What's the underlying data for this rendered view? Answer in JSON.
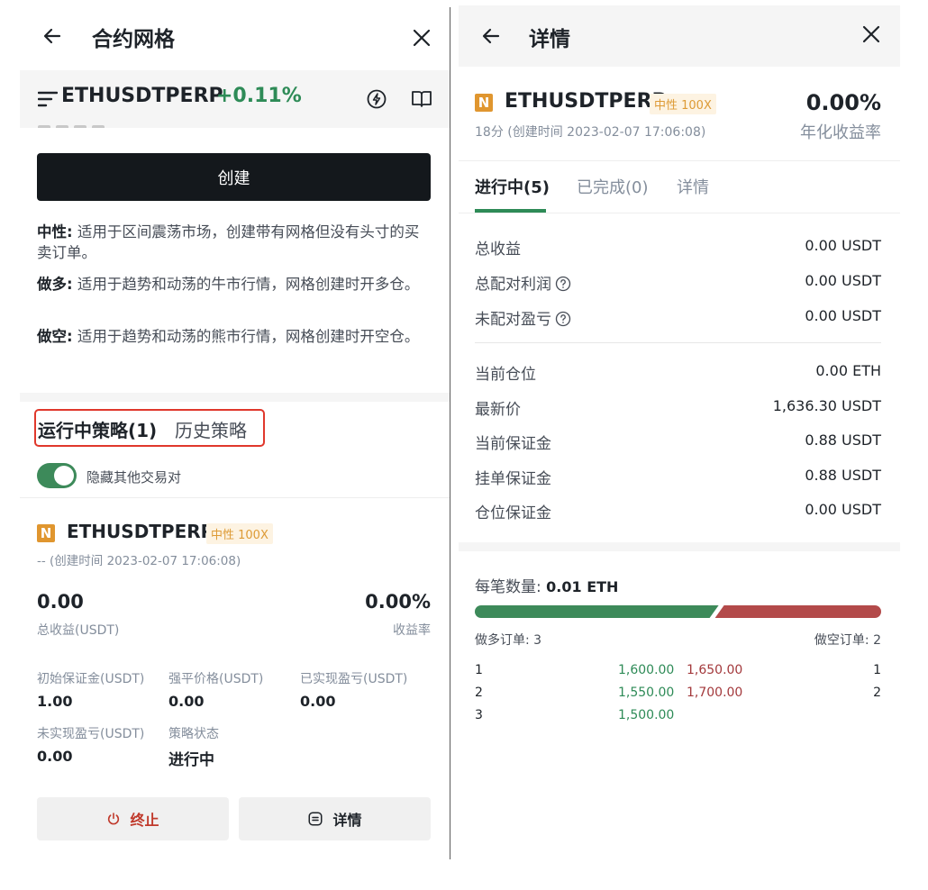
{
  "left": {
    "nav_title": "合约网格",
    "pair": {
      "symbol": "ETHUSDTPERP",
      "change": "+0.11%"
    },
    "create_label": "创建",
    "descriptions": [
      {
        "term": "中性:",
        "text": "适用于区间震荡市场，创建带有网格但没有头寸的买卖订单。"
      },
      {
        "term": "做多:",
        "text": "适用于趋势和动荡的牛市行情，网格创建时开多仓。"
      },
      {
        "term": "做空:",
        "text": "适用于趋势和动荡的熊市行情，网格创建时开空仓。"
      }
    ],
    "tabs": {
      "running": "运行中策略(1)",
      "history": "历史策略"
    },
    "toggle_label": "隐藏其他交易对",
    "card": {
      "badge": "N",
      "symbol": "ETHUSDTPERP",
      "tag": "中性 100X",
      "created": "-- (创建时间 2023-02-07 17:06:08)",
      "total_profit": "0.00",
      "total_profit_label": "总收益(USDT)",
      "yield": "0.00%",
      "yield_label": "收益率",
      "stats": [
        {
          "label": "初始保证金(USDT)",
          "value": "1.00"
        },
        {
          "label": "强平价格(USDT)",
          "value": "0.00"
        },
        {
          "label": "已实现盈亏(USDT)",
          "value": "0.00"
        },
        {
          "label": "未实现盈亏(USDT)",
          "value": "0.00"
        },
        {
          "label": "策略状态",
          "value": "进行中"
        }
      ],
      "stop_label": "终止",
      "detail_label": "详情"
    }
  },
  "right": {
    "nav_title": "详情",
    "badge": "N",
    "symbol": "ETHUSDTPERP",
    "tag": "中性 100X",
    "sub": "18分 (创建时间 2023-02-07 17:06:08)",
    "yield": "0.00%",
    "yield_label": "年化收益率",
    "tabs": [
      "进行中(5)",
      "已完成(0)",
      "详情"
    ],
    "profit_rows": [
      {
        "label": "总收益",
        "value": "0.00 USDT",
        "help": false
      },
      {
        "label": "总配对利润",
        "value": "0.00 USDT",
        "help": true
      },
      {
        "label": "未配对盈亏",
        "value": "0.00 USDT",
        "help": true
      }
    ],
    "position_rows": [
      {
        "label": "当前仓位",
        "value": "0.00 ETH"
      },
      {
        "label": "最新价",
        "value": "1,636.30 USDT"
      },
      {
        "label": "当前保证金",
        "value": "0.88 USDT"
      },
      {
        "label": "挂单保证金",
        "value": "0.88 USDT"
      },
      {
        "label": "仓位保证金",
        "value": "0.00 USDT"
      }
    ],
    "qty_label": "每笔数量:",
    "qty_value": "0.01 ETH",
    "long_share": 0.6,
    "long_label": "做多订单: 3",
    "short_label": "做空订单: 2",
    "long_orders": [
      {
        "index": "1",
        "price": "1,600.00"
      },
      {
        "index": "2",
        "price": "1,550.00"
      },
      {
        "index": "3",
        "price": "1,500.00"
      }
    ],
    "short_orders": [
      {
        "index": "1",
        "price": "1,650.00"
      },
      {
        "index": "2",
        "price": "1,700.00"
      }
    ],
    "colors": {
      "long": "#3d8a5a",
      "short": "#b34a4a",
      "accent": "#2e8b57",
      "highlight": "#e0382c"
    }
  }
}
